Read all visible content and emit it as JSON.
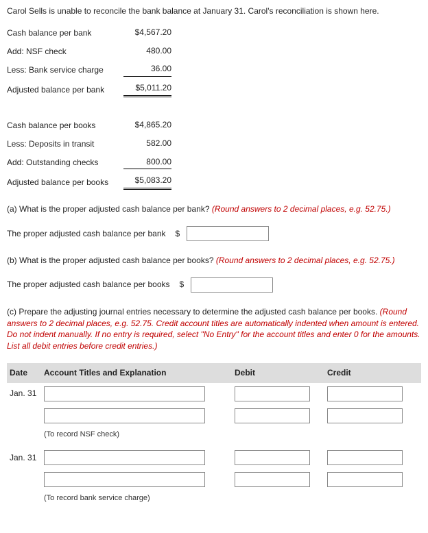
{
  "intro": "Carol Sells is unable to reconcile the bank balance at January 31. Carol's reconciliation is shown here.",
  "recon_bank": {
    "rows": [
      {
        "label": "Cash balance per bank",
        "value": "$4,567.20",
        "cls": ""
      },
      {
        "label": "Add: NSF check",
        "value": "480.00",
        "cls": ""
      },
      {
        "label": "Less: Bank service charge",
        "value": "36.00",
        "cls": "underline-single"
      },
      {
        "label": "Adjusted balance per bank",
        "value": "$5,011.20",
        "cls": "underline-double"
      }
    ]
  },
  "recon_books": {
    "rows": [
      {
        "label": "Cash balance per books",
        "value": "$4,865.20",
        "cls": ""
      },
      {
        "label": "Less: Deposits in transit",
        "value": "582.00",
        "cls": ""
      },
      {
        "label": "Add: Outstanding checks",
        "value": "800.00",
        "cls": "underline-single"
      },
      {
        "label": "Adjusted balance per books",
        "value": "$5,083.20",
        "cls": "underline-double"
      }
    ]
  },
  "qa": {
    "a_text": "(a) What is the proper adjusted cash balance per bank? ",
    "a_hint": "(Round answers to 2 decimal places, e.g. 52.75.)",
    "a_label": "The proper adjusted cash balance per bank",
    "b_text": "(b) What is the proper adjusted cash balance per books? ",
    "b_hint": "(Round answers to 2 decimal places, e.g. 52.75.)",
    "b_label": "The proper adjusted cash balance per books",
    "c_text": "(c) Prepare the adjusting journal entries necessary to determine the adjusted cash balance per books. ",
    "c_hint": "(Round answers to 2 decimal places, e.g. 52.75. Credit account titles are automatically indented when amount is entered. Do not indent manually. If no entry is required, select \"No Entry\" for the account titles and enter 0 for the amounts. List all debit entries before credit entries.)"
  },
  "je": {
    "headers": {
      "date": "Date",
      "account": "Account Titles and Explanation",
      "debit": "Debit",
      "credit": "Credit"
    },
    "date1": "Jan. 31",
    "hint1": "(To record NSF check)",
    "date2": "Jan. 31",
    "hint2": "(To record bank service charge)"
  },
  "dollar": "$"
}
